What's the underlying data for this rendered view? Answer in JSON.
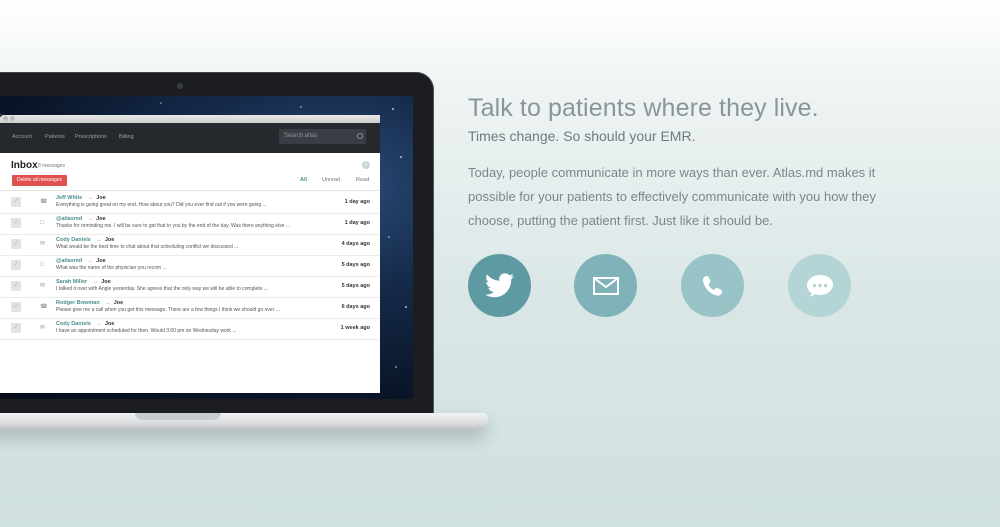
{
  "app": {
    "nav": [
      "Account",
      "Patients",
      "Prescriptions",
      "Billing"
    ],
    "search_placeholder": "Search atlas",
    "inbox_title": "Inbox",
    "inbox_count": "8 messages",
    "delete_label": "Delete all messages",
    "filters": [
      "All",
      "Unread",
      "Read"
    ],
    "messages": [
      {
        "from": "Jeff White",
        "to": "Joe",
        "preview": "Everything is going great on my end. How about you? Did you ever find out if you were going ...",
        "date": "1 day ago",
        "type": "phone"
      },
      {
        "from": "@atlasmd",
        "to": "Joe",
        "preview": "Thanks for reminding me. I will be sure to get that to you by the end of the day. Was there anything else ...",
        "date": "1 day ago",
        "type": "chat"
      },
      {
        "from": "Cody Daniels",
        "to": "Joe",
        "preview": "What would be the best time to chat about that scheduling conflict we discussed ...",
        "date": "4 days ago",
        "type": "email"
      },
      {
        "from": "@atlasmd",
        "to": "Joe",
        "preview": "What was the name of the physician you recom ...",
        "date": "5 days ago",
        "type": "chat"
      },
      {
        "from": "Sarah Miller",
        "to": "Joe",
        "preview": "I talked it over with Angie yesterday. She agrees that the only way we will be able to complete ...",
        "date": "5 days ago",
        "type": "email"
      },
      {
        "from": "Rodger Bowman",
        "to": "Joe",
        "preview": "Please give me a call when you get this message. There are a few things I think we should go over ...",
        "date": "6 days ago",
        "type": "phone"
      },
      {
        "from": "Cody Daniels",
        "to": "Joe",
        "preview": "I have an appointment scheduled for then. Would 3:00 pm on Wednesday work ...",
        "date": "1 week ago",
        "type": "email"
      }
    ]
  },
  "copy": {
    "headline": "Talk to patients where they live.",
    "subhead": "Times change. So should your EMR.",
    "paragraph": "Today, people communicate in more ways than ever. Atlas.md makes it possible for your patients to effectively communicate with you how they choose, putting the patient first. Just like it should be."
  },
  "channels": [
    "twitter-icon",
    "mail-icon",
    "phone-icon",
    "chat-icon"
  ],
  "colors": {
    "accent": "#4a8f90",
    "delete": "#e0524e",
    "twitter": "#5d9aa2",
    "mail": "#7fb3b9",
    "phone": "#98c3c7",
    "chat": "#b4d4d6"
  }
}
